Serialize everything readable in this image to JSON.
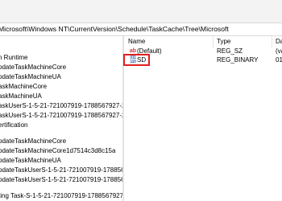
{
  "address_bar": {
    "path": "Microsoft\\Windows NT\\CurrentVersion\\Schedule\\TaskCache\\Tree\\Microsoft"
  },
  "tree": {
    "items": [
      {
        "label": "n Runtime"
      },
      {
        "label": "pdateTaskMachineCore"
      },
      {
        "label": "pdateTaskMachineUA"
      },
      {
        "label": "askMachineCore"
      },
      {
        "label": "askMachineUA"
      },
      {
        "label": "askUserS-1-5-21-721007919-1788567927-259"
      },
      {
        "label": "askUserS-1-5-21-721007919-1788567927-259"
      },
      {
        "label": "ertification"
      },
      {
        "label": "pdateTaskMachineCore"
      },
      {
        "label": "pdateTaskMachineCore1d7514c3d8c15a"
      },
      {
        "label": "pdateTaskMachineUA"
      },
      {
        "label": "pdateTaskUserS-1-5-21-721007919-1788567!"
      },
      {
        "label": "pdateTaskUserS-1-5-21-721007919-1788567!"
      },
      {
        "label": "ting Task-S-1-5-21-721007919-1788567927-"
      }
    ]
  },
  "values": {
    "columns": {
      "name": "Name",
      "type": "Type",
      "data": "Da"
    },
    "rows": [
      {
        "icon": "string-value-icon",
        "icon_text": "ab",
        "name": "(Default)",
        "type": "REG_SZ",
        "data": "(va"
      },
      {
        "icon": "binary-value-icon",
        "icon_text": "011\n110",
        "name": "SD",
        "type": "REG_BINARY",
        "data": "01"
      }
    ]
  },
  "colors": {
    "highlight": "#e02020",
    "string_icon": "#d1343b",
    "binary_icon": "#2b5fb5"
  }
}
